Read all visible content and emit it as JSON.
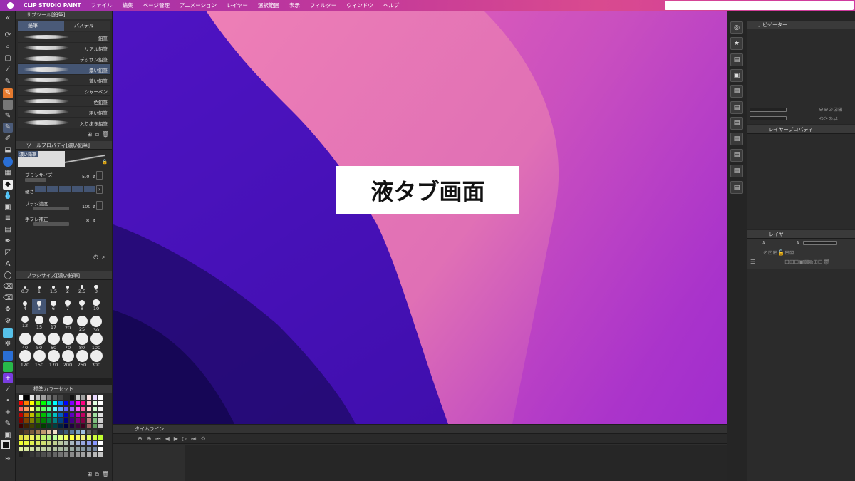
{
  "menubar": {
    "app": "CLIP STUDIO PAINT",
    "items": [
      "ファイル",
      "編集",
      "ページ管理",
      "アニメーション",
      "レイヤー",
      "選択範囲",
      "表示",
      "フィルター",
      "ウィンドウ",
      "ヘルプ"
    ]
  },
  "subtool": {
    "header": "サブツール[鉛筆]",
    "tab_pencil": "鉛筆",
    "tab_pastel": "パステル",
    "brushes": [
      "鉛筆",
      "リアル鉛筆",
      "デッサン鉛筆",
      "濃い鉛筆",
      "薄い鉛筆",
      "シャーペン",
      "色鉛筆",
      "粗い鉛筆",
      "入り抜き鉛筆"
    ],
    "selected_index": 3
  },
  "tool_property": {
    "header": "ツールプロパティ[濃い鉛筆]",
    "preview_label": "濃い鉛筆",
    "brush_size_label": "ブラシサイズ",
    "brush_size_value": "5.0",
    "hardness_label": "硬さ",
    "density_label": "ブラシ濃度",
    "density_value": "100",
    "stabilization_label": "手ブレ補正",
    "stabilization_value": "8"
  },
  "brush_size_panel": {
    "header": "ブラシサイズ[濃い鉛筆]",
    "sizes": [
      "0.7",
      "1",
      "1.5",
      "2",
      "2.5",
      "3",
      "4",
      "5",
      "6",
      "7",
      "8",
      "10",
      "12",
      "15",
      "17",
      "20",
      "25",
      "30",
      "40",
      "50",
      "60",
      "70",
      "80",
      "100",
      "120",
      "150",
      "170",
      "200",
      "250",
      "300"
    ],
    "selected": "5"
  },
  "color_set": {
    "header": "標準カラーセット"
  },
  "canvas": {
    "label": "液タブ画面"
  },
  "timeline": {
    "header": "タイムライン"
  },
  "right_panels": {
    "navigator": "ナビゲーター",
    "layer_property": "レイヤープロパティ",
    "layer": "レイヤー"
  },
  "colors": {
    "accent": "#445573",
    "panel_bg": "#2b2b2b",
    "menubar_start": "#9a2fb0",
    "menubar_end": "#d94a8f"
  }
}
